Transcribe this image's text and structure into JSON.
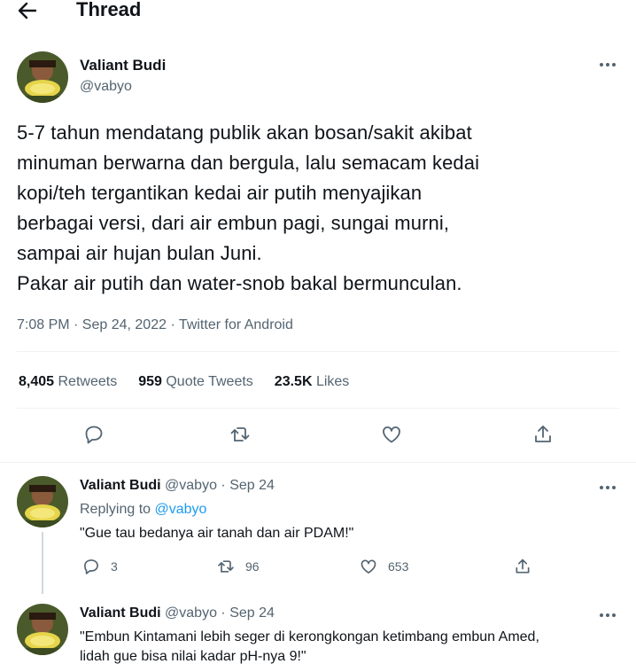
{
  "header": {
    "title": "Thread"
  },
  "main_tweet": {
    "author_name": "Valiant Budi",
    "author_handle": "@vabyo",
    "text": "5-7 tahun mendatang publik akan bosan/sakit akibat\nminuman berwarna dan bergula, lalu semacam kedai\nkopi/teh tergantikan kedai air putih menyajikan\nberbagai versi, dari air embun pagi, sungai murni,\nsampai air hujan bulan Juni.\nPakar air putih dan water-snob bakal bermunculan.",
    "meta": "7:08 PM · Sep 24, 2022 · Twitter for Android",
    "stats": {
      "retweets_count": "8,405",
      "retweets_label": "Retweets",
      "quotes_count": "959",
      "quotes_label": "Quote Tweets",
      "likes_count": "23.5K",
      "likes_label": "Likes"
    }
  },
  "replies": [
    {
      "author_name": "Valiant Budi",
      "author_handle": "@vabyo",
      "date": "· Sep 24",
      "replying_prefix": "Replying to",
      "replying_to": "@vabyo",
      "text": "\"Gue tau bedanya air tanah dan air PDAM!\"",
      "reply_count": "3",
      "retweet_count": "96",
      "like_count": "653"
    },
    {
      "author_name": "Valiant Budi",
      "author_handle": "@vabyo",
      "date": "· Sep 24",
      "text_line1": "\"Embun Kintamani lebih seger di kerongkongan ketimbang embun Amed,",
      "text_line2": "lidah gue bisa nilai kadar pH-nya 9!\""
    }
  ],
  "colors": {
    "text_primary": "#0f1419",
    "text_secondary": "#536471",
    "link": "#1d9bf0",
    "divider": "#eff3f4"
  },
  "icons": [
    "back-arrow-icon",
    "more-icon",
    "reply-icon",
    "retweet-icon",
    "like-icon",
    "share-icon"
  ]
}
